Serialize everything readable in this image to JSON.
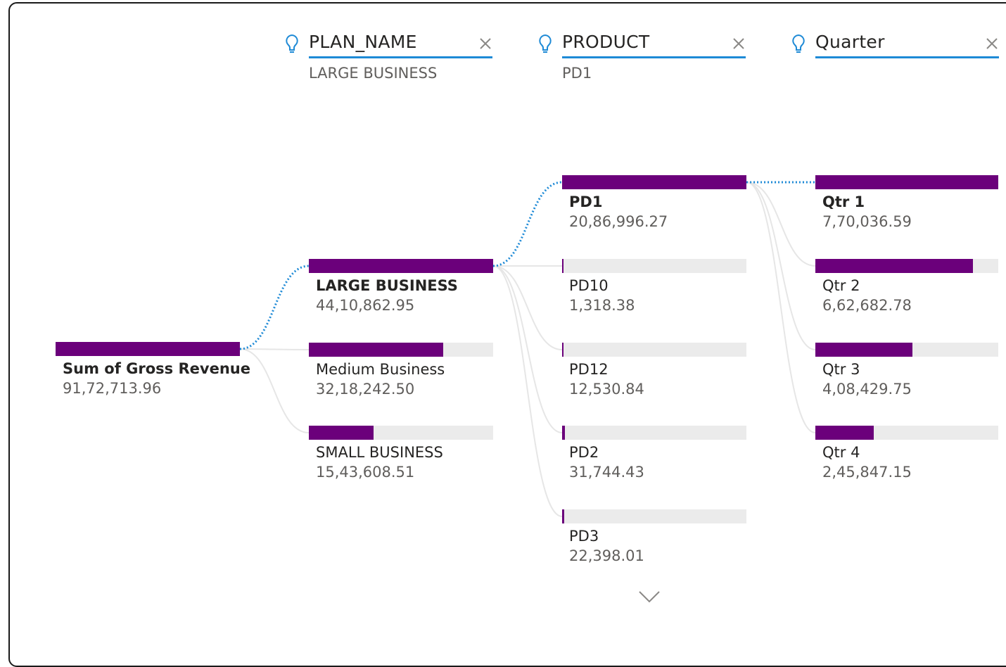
{
  "root": {
    "label": "Sum of Gross Revenue",
    "value": "91,72,713.96",
    "fraction": 1.0
  },
  "levels": [
    {
      "header": "PLAN_NAME",
      "selection": "LARGE BUSINESS",
      "nodes": [
        {
          "label": "LARGE BUSINESS",
          "value": "44,10,862.95",
          "fraction": 1.0,
          "selected": true
        },
        {
          "label": "Medium Business",
          "value": "32,18,242.50",
          "fraction": 0.73,
          "selected": false
        },
        {
          "label": "SMALL BUSINESS",
          "value": "15,43,608.51",
          "fraction": 0.35,
          "selected": false
        }
      ]
    },
    {
      "header": "PRODUCT",
      "selection": "PD1",
      "nodes": [
        {
          "label": "PD1",
          "value": "20,86,996.27",
          "fraction": 1.0,
          "selected": true
        },
        {
          "label": "PD10",
          "value": "1,318.38",
          "fraction": 0.004,
          "selected": false
        },
        {
          "label": "PD12",
          "value": "12,530.84",
          "fraction": 0.006,
          "selected": false
        },
        {
          "label": "PD2",
          "value": "31,744.43",
          "fraction": 0.015,
          "selected": false
        },
        {
          "label": "PD3",
          "value": "22,398.01",
          "fraction": 0.011,
          "selected": false
        }
      ]
    },
    {
      "header": "Quarter",
      "selection": "",
      "nodes": [
        {
          "label": "Qtr 1",
          "value": "7,70,036.59",
          "fraction": 1.0,
          "selected": true
        },
        {
          "label": "Qtr 2",
          "value": "6,62,682.78",
          "fraction": 0.86,
          "selected": false
        },
        {
          "label": "Qtr 3",
          "value": "4,08,429.75",
          "fraction": 0.53,
          "selected": false
        },
        {
          "label": "Qtr 4",
          "value": "2,45,847.15",
          "fraction": 0.32,
          "selected": false
        }
      ]
    }
  ],
  "colors": {
    "bar": "#6b007b",
    "track": "#ebebeb",
    "selected_path": "#1e8ad6",
    "connector": "#e6e6e6",
    "header_underline": "#1e8ad6"
  },
  "icons": {
    "insight": "lightbulb-icon",
    "remove": "close-icon",
    "expand": "chevron-down-icon"
  }
}
